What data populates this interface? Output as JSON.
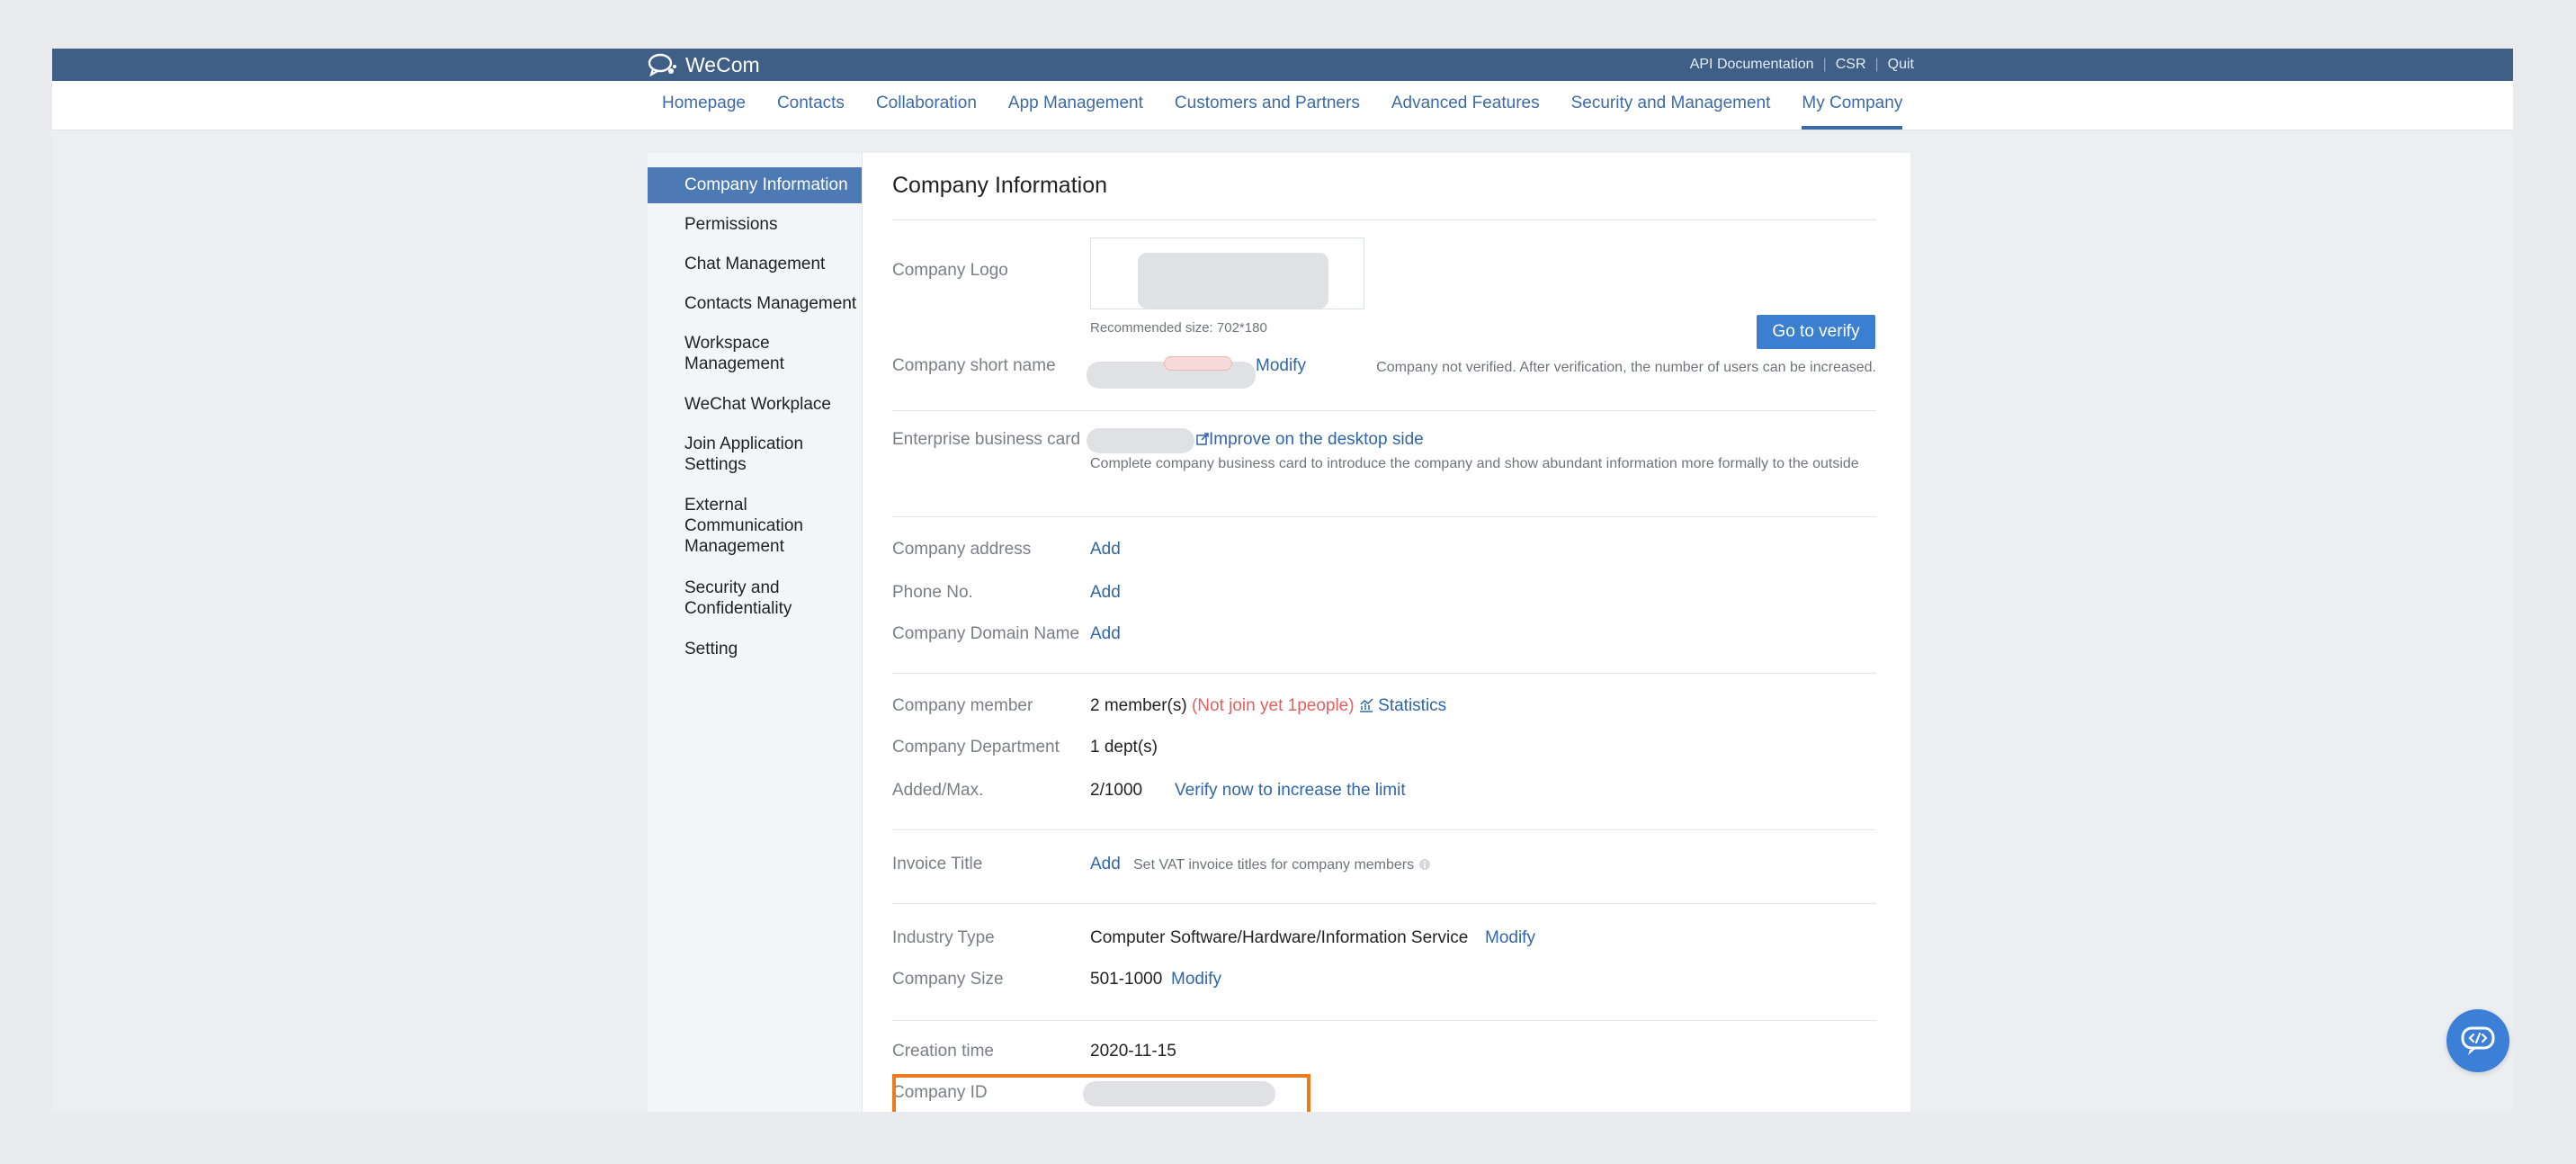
{
  "app": {
    "name": "WeCom"
  },
  "top_links": [
    "API Documentation",
    "CSR",
    "Quit"
  ],
  "nav": {
    "items": [
      "Homepage",
      "Contacts",
      "Collaboration",
      "App Management",
      "Customers and Partners",
      "Advanced Features",
      "Security and Management",
      "My Company"
    ],
    "active": "My Company"
  },
  "sidebar": {
    "items": [
      {
        "label": "Company Information"
      },
      {
        "label": "Permissions"
      },
      {
        "label": "Chat Management"
      },
      {
        "label": "Contacts Management"
      },
      {
        "label": "Workspace Management"
      },
      {
        "label": "WeChat Workplace"
      },
      {
        "label": "Join Application Settings"
      },
      {
        "label": "External Communication Management"
      },
      {
        "label": "Security and Confidentiality"
      },
      {
        "label": "Setting"
      }
    ],
    "active": "Company Information"
  },
  "page": {
    "title": "Company Information",
    "logo": {
      "label": "Company Logo",
      "hint": "Recommended size: 702*180"
    },
    "short_name": {
      "label": "Company short name",
      "modify": "Modify"
    },
    "verify": {
      "button": "Go to verify",
      "note": "Company not verified. After verification, the number of users can be increased."
    },
    "business_card": {
      "label": "Enterprise business card",
      "link": "Improve on the desktop side",
      "desc": "Complete company business card to introduce the company and show abundant information more formally to the outside"
    },
    "address": {
      "label": "Company address",
      "action": "Add"
    },
    "phone": {
      "label": "Phone No.",
      "action": "Add"
    },
    "domain": {
      "label": "Company Domain Name",
      "action": "Add"
    },
    "member": {
      "label": "Company member",
      "value": "2 member(s)",
      "not_joined": "(Not join yet 1people)",
      "stats": "Statistics"
    },
    "department": {
      "label": "Company Department",
      "value": "1 dept(s)"
    },
    "added_max": {
      "label": "Added/Max.",
      "value": "2/1000",
      "link": "Verify now to increase the limit"
    },
    "invoice": {
      "label": "Invoice Title",
      "action": "Add",
      "hint": "Set VAT invoice titles for company members"
    },
    "industry": {
      "label": "Industry Type",
      "value": "Computer Software/Hardware/Information Service",
      "modify": "Modify"
    },
    "size": {
      "label": "Company Size",
      "value": "501-1000",
      "modify": "Modify"
    },
    "created": {
      "label": "Creation time",
      "value": "2020-11-15"
    },
    "company_id": {
      "label": "Company ID"
    }
  },
  "colors": {
    "topbar": "#3f5f87",
    "accent": "#3e6aa5",
    "link": "#2f66a8",
    "button": "#3b7fd0",
    "highlight": "#ee7a1e",
    "warn": "#e26060"
  }
}
